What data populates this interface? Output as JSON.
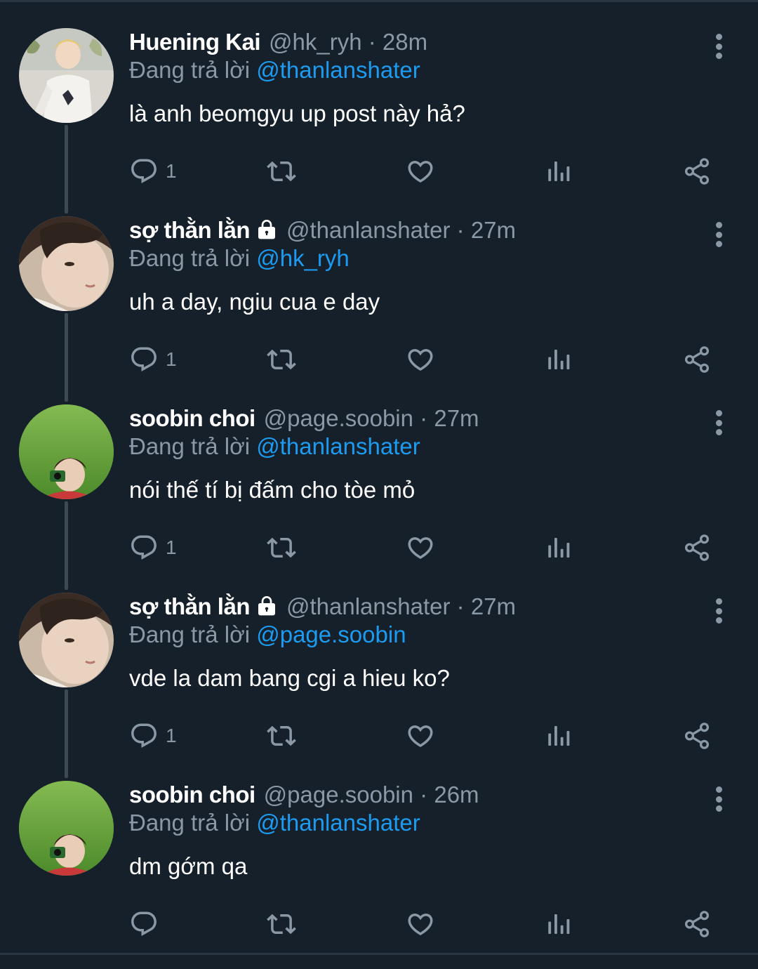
{
  "tweets": [
    {
      "name": "Huening Kai",
      "handle": "@hk_ryh",
      "time": "28m",
      "separator": "·",
      "locked": false,
      "replying_label": "Đang trả lời",
      "replying_to": "@thanlanshater",
      "text": "là anh beomgyu up post này hả?",
      "reply_count": "1",
      "avatar": "avatar-light-outfit"
    },
    {
      "name": "sợ thằn lằn",
      "handle": "@thanlanshater",
      "time": "27m",
      "separator": "·",
      "locked": true,
      "replying_label": "Đang trả lời",
      "replying_to": "@hk_ryh",
      "text": "uh a day, ngiu cua e day",
      "reply_count": "1",
      "avatar": "avatar-face-closeup"
    },
    {
      "name": "soobin choi",
      "handle": "@page.soobin",
      "time": "27m",
      "separator": "·",
      "locked": false,
      "replying_label": "Đang trả lời",
      "replying_to": "@thanlanshater",
      "text": "nói thế tí bị đấm cho tòe mỏ",
      "reply_count": "1",
      "avatar": "avatar-grass-camera"
    },
    {
      "name": "sợ thằn lằn",
      "handle": "@thanlanshater",
      "time": "27m",
      "separator": "·",
      "locked": true,
      "replying_label": "Đang trả lời",
      "replying_to": "@page.soobin",
      "text": "vde la dam bang cgi a hieu ko?",
      "reply_count": "1",
      "avatar": "avatar-face-closeup"
    },
    {
      "name": "soobin choi",
      "handle": "@page.soobin",
      "time": "26m",
      "separator": "·",
      "locked": false,
      "replying_label": "Đang trả lời",
      "replying_to": "@thanlanshater",
      "text": "dm gớm qa",
      "reply_count": "",
      "avatar": "avatar-grass-camera"
    }
  ],
  "icons": {
    "reply": "reply-icon",
    "retweet": "retweet-icon",
    "like": "heart-icon",
    "stats": "stats-icon",
    "share": "share-icon",
    "more": "more-vertical-icon",
    "lock": "lock-icon"
  },
  "colors": {
    "background": "#15202b",
    "text": "#ffffff",
    "muted": "#8b98a5",
    "accent": "#1d9bf0",
    "thread_line": "#3d4a56"
  }
}
